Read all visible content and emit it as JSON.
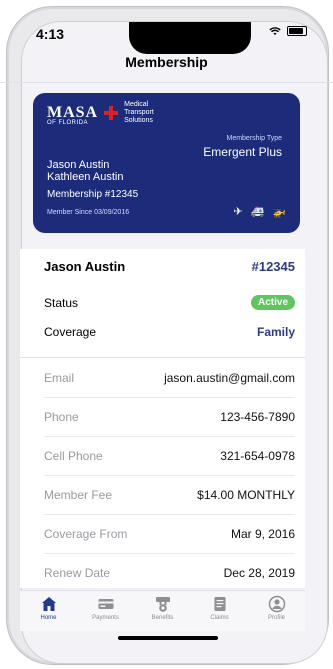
{
  "status": {
    "time": "4:13"
  },
  "nav": {
    "title": "Membership"
  },
  "card": {
    "brand": "MASA",
    "brand_sub": "OF FLORIDA",
    "company_line1": "Medical",
    "company_line2": "Transport",
    "company_line3": "Solutions",
    "membership_type_label": "Membership Type",
    "membership_type_value": "Emergent Plus",
    "name1": "Jason Austin",
    "name2": "Kathleen Austin",
    "membership_number": "Membership #12345",
    "member_since": "Member Since 03/09/2016",
    "icons": [
      "plane-icon",
      "ambulance-icon",
      "helicopter-icon"
    ]
  },
  "summary": {
    "name": "Jason Austin",
    "number": "#12345",
    "status_label": "Status",
    "status_value": "Active",
    "coverage_label": "Coverage",
    "coverage_value": "Family"
  },
  "details": [
    {
      "label": "Email",
      "value": "jason.austin@gmail.com"
    },
    {
      "label": "Phone",
      "value": "123-456-7890"
    },
    {
      "label": "Cell Phone",
      "value": "321-654-0978"
    },
    {
      "label": "Member Fee",
      "value": "$14.00 MONTHLY"
    },
    {
      "label": "Coverage From",
      "value": "Mar 9, 2016"
    },
    {
      "label": "Renew Date",
      "value": "Dec 28, 2019"
    }
  ],
  "tabs": [
    {
      "label": "Home",
      "icon": "home-icon",
      "active": true
    },
    {
      "label": "Payments",
      "icon": "credit-card-icon",
      "active": false
    },
    {
      "label": "Benefits",
      "icon": "benefits-icon",
      "active": false
    },
    {
      "label": "Claims",
      "icon": "document-icon",
      "active": false
    },
    {
      "label": "Profile",
      "icon": "profile-icon",
      "active": false
    }
  ],
  "colors": {
    "card": "#1c2c7a",
    "accent": "#2f3a86",
    "active_badge": "#5cc85c"
  }
}
